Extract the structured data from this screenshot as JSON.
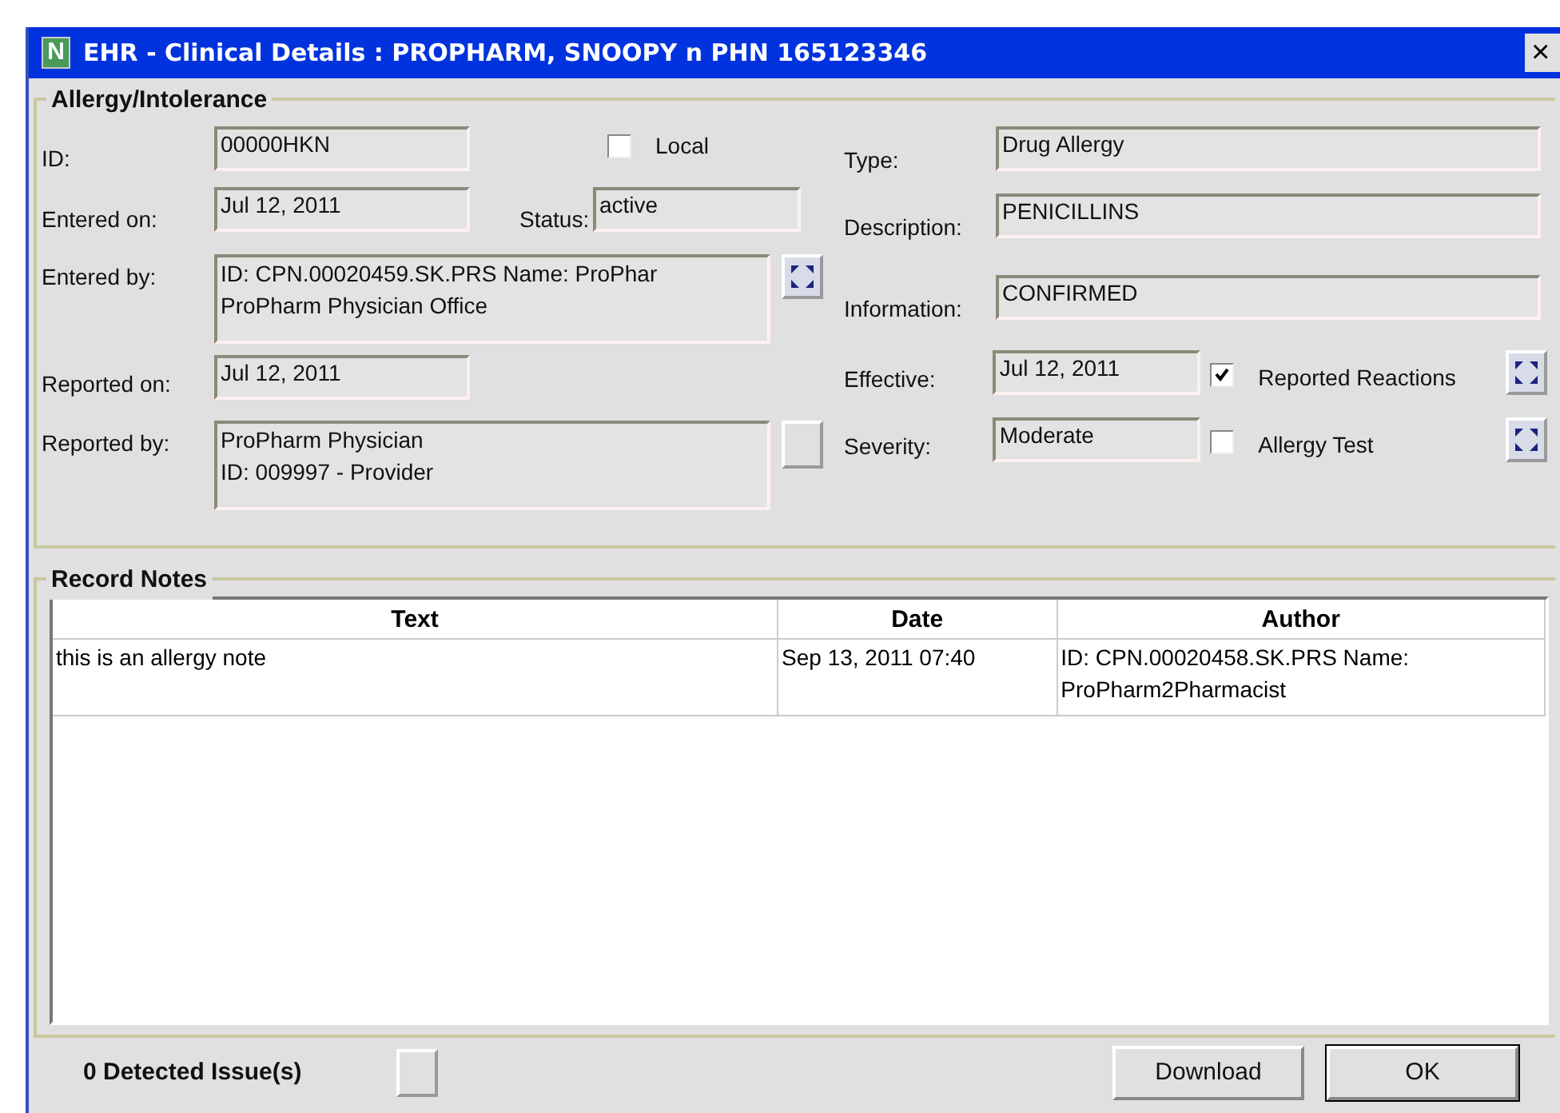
{
  "window": {
    "logo": "N",
    "title": "EHR - Clinical Details : PROPHARM, SNOOPY n PHN 165123346",
    "close": "×"
  },
  "allergy": {
    "title": "Allergy/Intolerance",
    "id": {
      "label": "ID:",
      "value": "00000HKN"
    },
    "local": {
      "label": "Local",
      "checked": false
    },
    "entered_on": {
      "label": "Entered on:",
      "value": "Jul 12, 2011"
    },
    "status": {
      "label": "Status:",
      "value": "active"
    },
    "entered_by": {
      "label": "Entered by:",
      "lines": [
        "ID: CPN.00020459.SK.PRS Name: ProPhar",
        "ProPharm Physician Office"
      ]
    },
    "reported_on": {
      "label": "Reported on:",
      "value": "Jul 12, 2011"
    },
    "reported_by": {
      "label": "Reported by:",
      "lines": [
        "ProPharm Physician",
        "ID: 009997 - Provider"
      ]
    },
    "type": {
      "label": "Type:",
      "value": "Drug Allergy"
    },
    "description": {
      "label": "Description:",
      "value": "PENICILLINS"
    },
    "information": {
      "label": "Information:",
      "value": "CONFIRMED"
    },
    "effective": {
      "label": "Effective:",
      "value": "Jul 12, 2011"
    },
    "reported_reactions": {
      "label": "Reported Reactions",
      "checked": true
    },
    "severity": {
      "label": "Severity:",
      "value": "Moderate"
    },
    "allergy_test": {
      "label": "Allergy Test",
      "checked": false
    }
  },
  "notes": {
    "title": "Record Notes",
    "columns": [
      "Text",
      "Date",
      "Author"
    ],
    "rows": [
      {
        "cells": [
          "this is an allergy note",
          "Sep 13, 2011 07:40",
          "ID: CPN.00020458.SK.PRS Name: ProPharm2Pharmacist"
        ]
      }
    ]
  },
  "footer": {
    "issues": "0 Detected Issue(s)",
    "buttons": [
      "Download",
      "OK"
    ]
  }
}
